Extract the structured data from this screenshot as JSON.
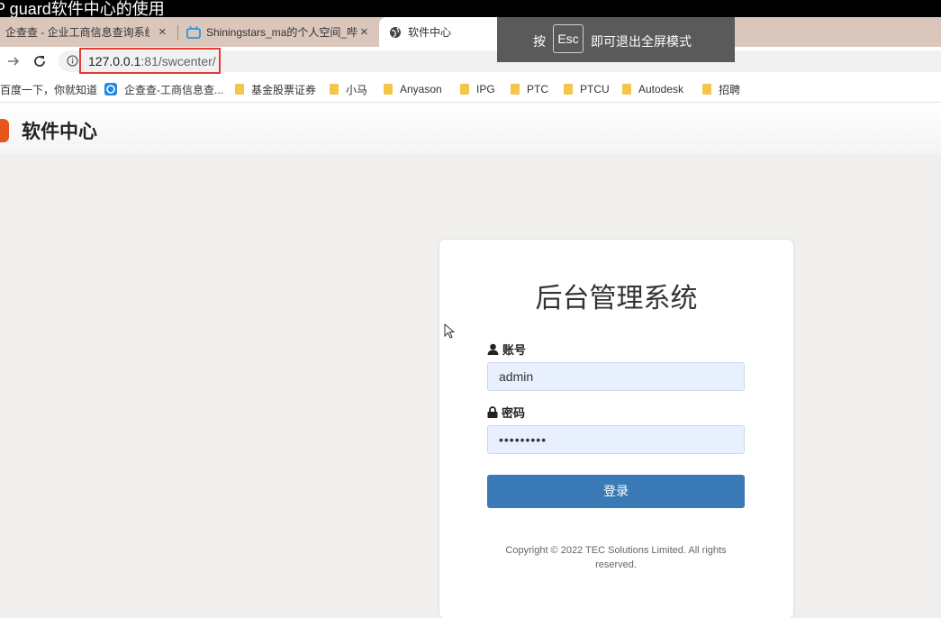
{
  "window_title": "P guard软件中心的使用",
  "tabs": [
    {
      "label": "企查查 - 企业工商信息查询系统",
      "active": false
    },
    {
      "label": "Shiningstars_ma的个人空间_哔",
      "active": false
    },
    {
      "label": "软件中心",
      "active": true
    }
  ],
  "tab_close_glyph": "×",
  "address_bar": {
    "host": "127.0.0.1",
    "port_path": ":81/swcenter/"
  },
  "bookmarks": [
    {
      "label": "百度一下，你就知道",
      "type": "page"
    },
    {
      "label": "企查查-工商信息查...",
      "type": "page"
    },
    {
      "label": "基金股票证券",
      "type": "folder"
    },
    {
      "label": "小马",
      "type": "folder"
    },
    {
      "label": "Anyason",
      "type": "folder"
    },
    {
      "label": "IPG",
      "type": "folder"
    },
    {
      "label": "PTC",
      "type": "folder"
    },
    {
      "label": "PTCU",
      "type": "folder"
    },
    {
      "label": "Autodesk",
      "type": "folder"
    },
    {
      "label": "招聘",
      "type": "folder"
    }
  ],
  "fullscreen_toast": {
    "prefix": "按",
    "key": "Esc",
    "suffix": "即可退出全屏模式"
  },
  "site": {
    "title": "软件中心"
  },
  "login": {
    "title": "后台管理系统",
    "account_label": "账号",
    "account_value": "admin",
    "password_label": "密码",
    "password_value": "•••••••••",
    "button_label": "登录",
    "copyright_line1": "Copyright © 2022 TEC Solutions Limited. All rights",
    "copyright_line2": "reserved."
  },
  "colors": {
    "primary_button": "#3a7ab6",
    "url_highlight": "#e53935",
    "input_bg": "#e8f0fe"
  }
}
